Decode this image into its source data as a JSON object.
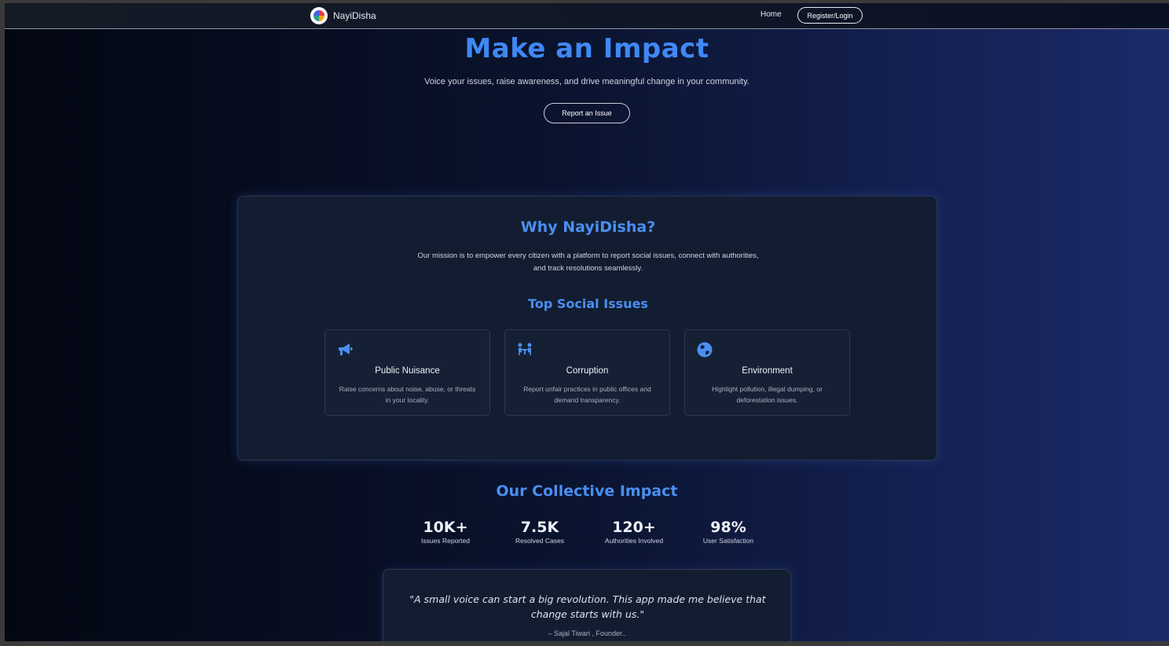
{
  "nav": {
    "brand": "NayiDisha",
    "logo_icon": "colorful-circle-logo",
    "home": "Home",
    "login": "Register/Login"
  },
  "hero": {
    "title": "Make an Impact",
    "subtitle": "Voice your issues, raise awareness, and drive meaningful change in your community.",
    "button": "Report an Issue"
  },
  "why": {
    "title": "Why NayiDisha?",
    "text": "Our mission is to empower every citizen with a platform to report social issues, connect with authorities, and track resolutions seamlessly.",
    "top_title": "Top Social Issues",
    "issues": [
      {
        "icon": "megaphone-icon",
        "title": "Public Nuisance",
        "desc": "Raise concerns about noise, abuse, or threats in your locality."
      },
      {
        "icon": "people-table-icon",
        "title": "Corruption",
        "desc": "Report unfair practices in public offices and demand transparency."
      },
      {
        "icon": "globe-icon",
        "title": "Environment",
        "desc": "Highlight pollution, illegal dumping, or deforestation issues."
      }
    ]
  },
  "impact": {
    "title": "Our Collective Impact",
    "stats": [
      {
        "value": "10K+",
        "label": "Issues Reported"
      },
      {
        "value": "7.5K",
        "label": "Resolved Cases"
      },
      {
        "value": "120+",
        "label": "Authorities Involved"
      },
      {
        "value": "98%",
        "label": "User Satisfaction"
      }
    ]
  },
  "quote": {
    "text": "\"A small voice can start a big revolution. This app made me believe that change starts with us.\"",
    "author": "– Sajal Tiwari , Founder.."
  },
  "colors": {
    "accent": "#3f88f5",
    "heading": "#4a8ff0",
    "card_bg": "#131d31"
  }
}
